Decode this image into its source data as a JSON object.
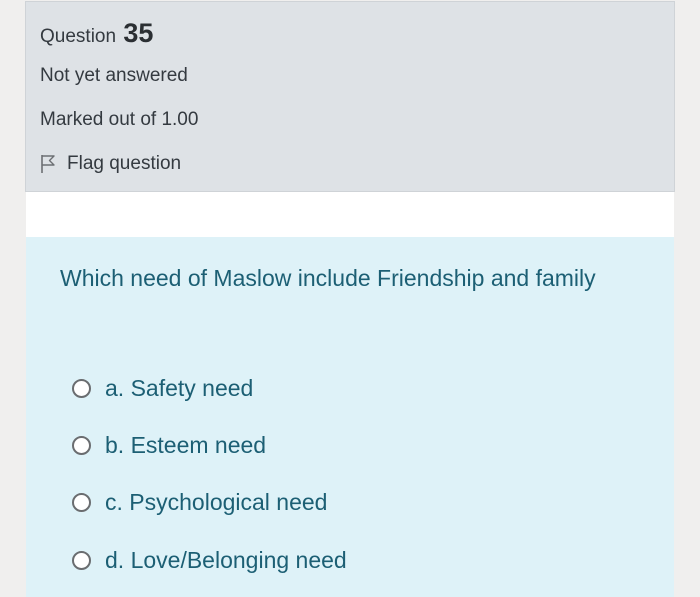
{
  "info": {
    "question_label": "Question",
    "question_number": "35",
    "state": "Not yet answered",
    "grade": "Marked out of 1.00",
    "flag_label": "Flag question"
  },
  "question": {
    "text": "Which need of Maslow include Friendship and family",
    "answers": [
      {
        "label": "a. Safety need",
        "selected": false
      },
      {
        "label": "b. Esteem need",
        "selected": false
      },
      {
        "label": "c. Psychological need",
        "selected": false
      },
      {
        "label": "d. Love/Belonging need",
        "selected": false
      }
    ]
  },
  "colors": {
    "info_background": "#dee2e6",
    "formulation_background": "#def2f8",
    "question_text": "#1c5f74"
  },
  "icons": {
    "flag": "flag-icon",
    "radio": "radio-button-icon"
  }
}
